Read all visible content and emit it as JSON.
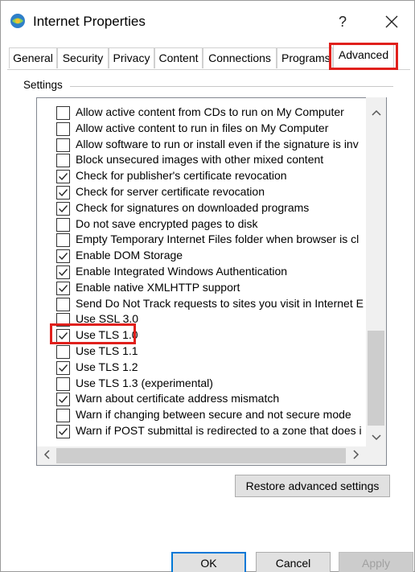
{
  "window": {
    "title": "Internet Properties",
    "help_label": "?",
    "close_icon": "close-icon"
  },
  "tabs": [
    {
      "label": "General"
    },
    {
      "label": "Security"
    },
    {
      "label": "Privacy"
    },
    {
      "label": "Content"
    },
    {
      "label": "Connections"
    },
    {
      "label": "Programs"
    },
    {
      "label": "Advanced",
      "active": true
    }
  ],
  "settings": {
    "group_label": "Settings",
    "items": [
      {
        "label": "Allow active content from CDs to run on My Computer",
        "checked": false
      },
      {
        "label": "Allow active content to run in files on My Computer",
        "checked": false
      },
      {
        "label": "Allow software to run or install even if the signature is inv",
        "checked": false
      },
      {
        "label": "Block unsecured images with other mixed content",
        "checked": false
      },
      {
        "label": "Check for publisher's certificate revocation",
        "checked": true
      },
      {
        "label": "Check for server certificate revocation",
        "checked": true
      },
      {
        "label": "Check for signatures on downloaded programs",
        "checked": true
      },
      {
        "label": "Do not save encrypted pages to disk",
        "checked": false
      },
      {
        "label": "Empty Temporary Internet Files folder when browser is cl",
        "checked": false
      },
      {
        "label": "Enable DOM Storage",
        "checked": true
      },
      {
        "label": "Enable Integrated Windows Authentication",
        "checked": true
      },
      {
        "label": "Enable native XMLHTTP support",
        "checked": true
      },
      {
        "label": "Send Do Not Track requests to sites you visit in Internet E",
        "checked": false
      },
      {
        "label": "Use SSL 3.0",
        "checked": false
      },
      {
        "label": "Use TLS 1.0",
        "checked": true
      },
      {
        "label": "Use TLS 1.1",
        "checked": false
      },
      {
        "label": "Use TLS 1.2",
        "checked": true
      },
      {
        "label": "Use TLS 1.3 (experimental)",
        "checked": false
      },
      {
        "label": "Warn about certificate address mismatch",
        "checked": true
      },
      {
        "label": "Warn if changing between secure and not secure mode",
        "checked": false
      },
      {
        "label": "Warn if POST submittal is redirected to a zone that does i",
        "checked": true
      }
    ]
  },
  "buttons": {
    "restore": "Restore advanced settings",
    "ok": "OK",
    "cancel": "Cancel",
    "apply": "Apply"
  },
  "colors": {
    "highlight": "#e0201c",
    "default_button_border": "#0078d7"
  }
}
